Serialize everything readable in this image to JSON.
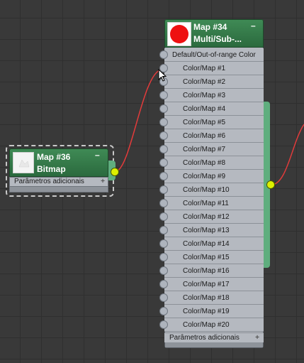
{
  "colors": {
    "canvas_bg": "#393939",
    "node_header": "#2b6a3e",
    "node_body": "#b5b9c0",
    "wire": "#e23b3b",
    "output_socket": "#ddf000",
    "swatch_red": "#ee1111"
  },
  "nodes": {
    "bitmap": {
      "title_line1": "Map #36",
      "title_line2": "Bitmap",
      "collapse_glyph": "–",
      "params_label": "Parâmetros adicionais",
      "params_glyph": "+",
      "thumbnail_icon": "bitmap-thumbnail-icon"
    },
    "multisub": {
      "title_line1": "Map #34",
      "title_line2": "Multi/Sub-...",
      "collapse_glyph": "–",
      "params_label": "Parâmetros adicionais",
      "params_glyph": "+",
      "thumbnail_icon": "red-circle-swatch-icon",
      "inputs": [
        "Default/Out-of-range Color",
        "Color/Map #1",
        "Color/Map #2",
        "Color/Map #3",
        "Color/Map #4",
        "Color/Map #5",
        "Color/Map #6",
        "Color/Map #7",
        "Color/Map #8",
        "Color/Map #9",
        "Color/Map #10",
        "Color/Map #11",
        "Color/Map #12",
        "Color/Map #13",
        "Color/Map #14",
        "Color/Map #15",
        "Color/Map #16",
        "Color/Map #17",
        "Color/Map #18",
        "Color/Map #19",
        "Color/Map #20"
      ]
    }
  }
}
